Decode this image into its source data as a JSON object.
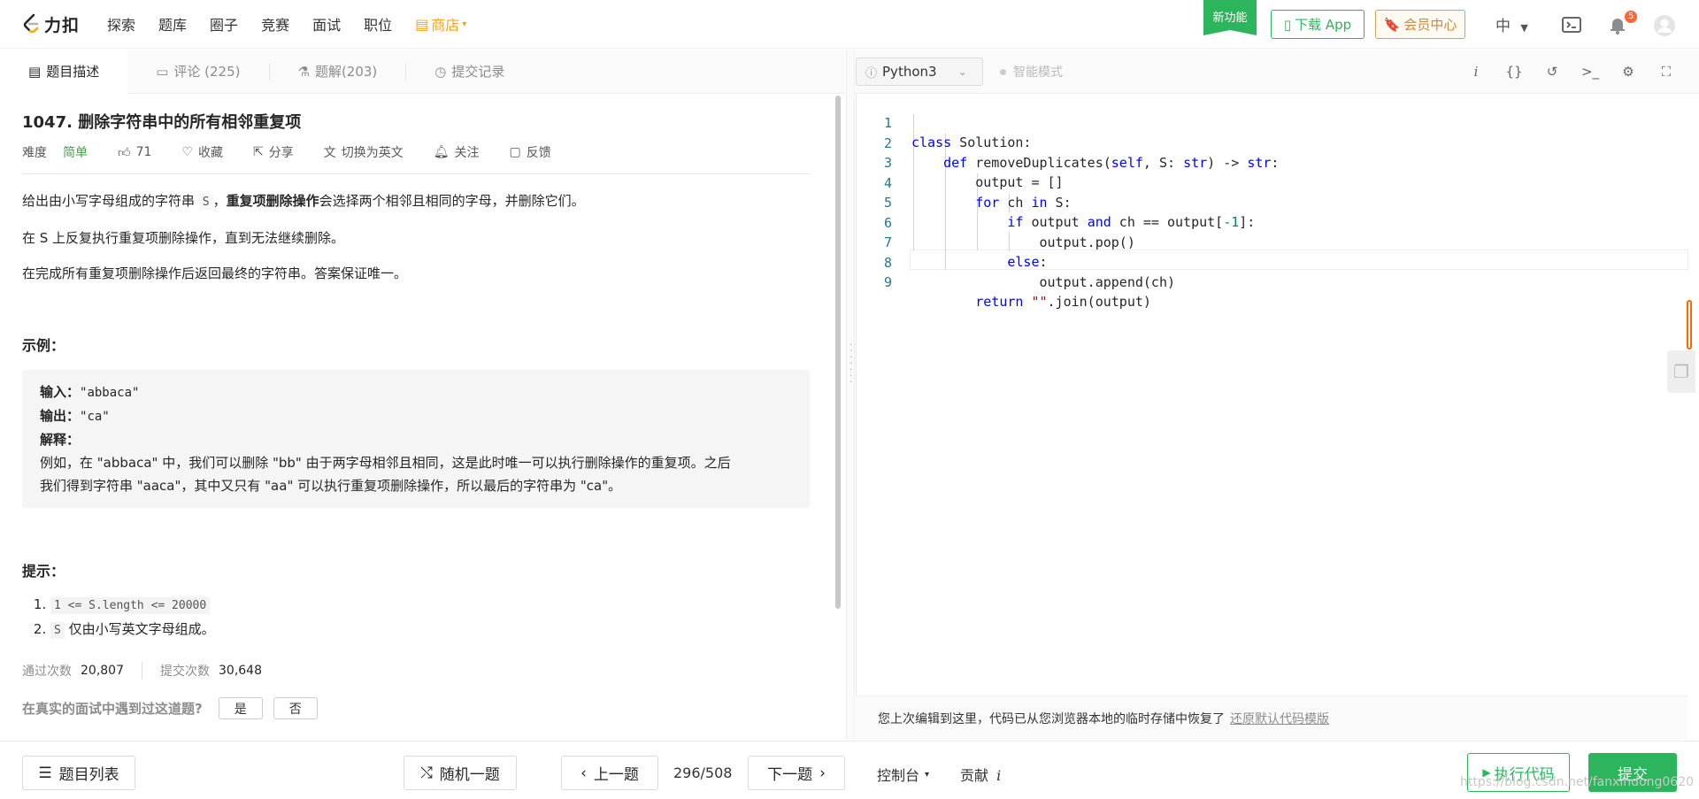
{
  "nav": {
    "brand": "力扣",
    "items": [
      "探索",
      "题库",
      "圈子",
      "竞赛",
      "面试",
      "职位"
    ],
    "store": "商店",
    "new_feature": "新功能",
    "download_app": "下载 App",
    "vip_center": "会员中心",
    "language": "中",
    "notification_count": "5"
  },
  "tabs": [
    {
      "label": "题目描述"
    },
    {
      "label": "评论 (225)"
    },
    {
      "label": "题解(203)"
    },
    {
      "label": "提交记录"
    }
  ],
  "problem": {
    "title": "1047. 删除字符串中的所有相邻重复项",
    "difficulty_label": "难度",
    "difficulty": "简单",
    "likes": "71",
    "favorite": "收藏",
    "share": "分享",
    "switch_lang": "切换为英文",
    "follow": "关注",
    "feedback": "反馈",
    "desc_p1_a": "给出由小写字母组成的字符串 ",
    "desc_p1_code": "S",
    "desc_p1_b": "，",
    "desc_p1_bold": "重复项删除操作",
    "desc_p1_c": "会选择两个相邻且相同的字母，并删除它们。",
    "desc_p2": "在 S 上反复执行重复项删除操作，直到无法继续删除。",
    "desc_p3": "在完成所有重复项删除操作后返回最终的字符串。答案保证唯一。",
    "example_heading": "示例：",
    "example_input_label": "输入：",
    "example_input": "\"abbaca\"",
    "example_output_label": "输出：",
    "example_output": "\"ca\"",
    "example_explain_label": "解释：",
    "example_explain_1": "例如，在 \"abbaca\" 中，我们可以删除 \"bb\" 由于两字母相邻且相同，这是此时唯一可以执行删除操作的重复项。之后",
    "example_explain_2": "我们得到字符串 \"aaca\"，其中又只有 \"aa\" 可以执行重复项删除操作，所以最后的字符串为 \"ca\"。",
    "hints_heading": "提示：",
    "hint1_code": "1 <= S.length <= 20000",
    "hint2_code": "S",
    "hint2_text": " 仅由小写英文字母组成。",
    "accepted_label": "通过次数",
    "accepted": "20,807",
    "submissions_label": "提交次数",
    "submissions": "30,648",
    "interview_q": "在真实的面试中遇到过这道题?",
    "yes": "是",
    "no": "否"
  },
  "editor": {
    "language": "Python3",
    "smart_mode": "智能模式",
    "lines": [
      "1",
      "2",
      "3",
      "4",
      "5",
      "6",
      "7",
      "8",
      "9"
    ],
    "restore_msg": "您上次编辑到这里，代码已从您浏览器本地的临时存储中恢复了",
    "restore_link": "还原默认代码模版"
  },
  "bottom": {
    "problem_list": "题目列表",
    "random": "随机一题",
    "prev": "上一题",
    "page": "296/508",
    "next": "下一题",
    "console": "控制台",
    "contribute": "贡献",
    "run": "执行代码",
    "submit": "提交",
    "watermark": "https://blog.csdn.net/fanxindong0620"
  },
  "colors": {
    "accent_green": "#2db55d",
    "store_orange": "#ffa116",
    "easy_green": "#43a047"
  }
}
